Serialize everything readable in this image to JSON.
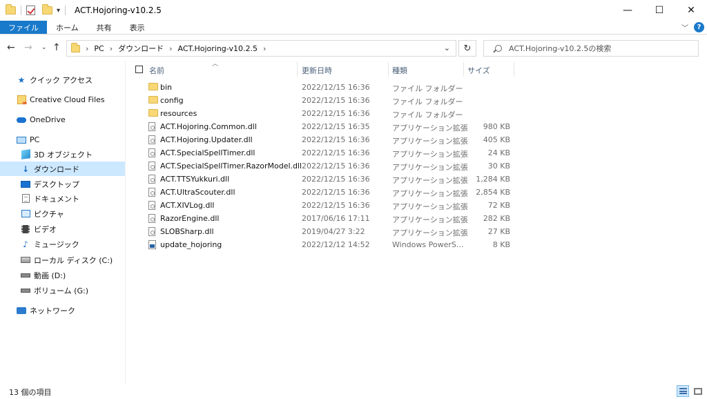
{
  "window": {
    "title": "ACT.Hojoring-v10.2.5",
    "controls": {
      "minimize": "—",
      "maximize": "☐",
      "close": "✕"
    }
  },
  "ribbon": {
    "tabs": [
      "ファイル",
      "ホーム",
      "共有",
      "表示"
    ],
    "help": "?"
  },
  "address": {
    "crumbs": [
      "PC",
      "ダウンロード",
      "ACT.Hojoring-v10.2.5"
    ],
    "separator": "›"
  },
  "search": {
    "placeholder": "ACT.Hojoring-v10.2.5の検索"
  },
  "sidebar": {
    "items": [
      {
        "label": "クイック アクセス",
        "icon": "star-icon"
      },
      {
        "label": "Creative Cloud Files",
        "icon": "creative-cloud-icon"
      },
      {
        "label": "OneDrive",
        "icon": "onedrive-icon"
      },
      {
        "label": "PC",
        "icon": "pc-icon"
      },
      {
        "label": "3D オブジェクト",
        "icon": "3d-objects-icon"
      },
      {
        "label": "ダウンロード",
        "icon": "download-icon",
        "selected": true
      },
      {
        "label": "デスクトップ",
        "icon": "desktop-icon"
      },
      {
        "label": "ドキュメント",
        "icon": "documents-icon"
      },
      {
        "label": "ピクチャ",
        "icon": "pictures-icon"
      },
      {
        "label": "ビデオ",
        "icon": "videos-icon"
      },
      {
        "label": "ミュージック",
        "icon": "music-icon"
      },
      {
        "label": "ローカル ディスク (C:)",
        "icon": "local-disk-icon"
      },
      {
        "label": "動画 (D:)",
        "icon": "drive-icon"
      },
      {
        "label": "ボリューム (G:)",
        "icon": "drive-icon"
      },
      {
        "label": "ネットワーク",
        "icon": "network-icon"
      }
    ]
  },
  "columns": {
    "name": "名前",
    "date": "更新日時",
    "type": "種類",
    "size": "サイズ"
  },
  "files": [
    {
      "name": "bin",
      "date": "2022/12/15 16:36",
      "type": "ファイル フォルダー",
      "size": "",
      "kind": "folder"
    },
    {
      "name": "config",
      "date": "2022/12/15 16:36",
      "type": "ファイル フォルダー",
      "size": "",
      "kind": "folder"
    },
    {
      "name": "resources",
      "date": "2022/12/15 16:36",
      "type": "ファイル フォルダー",
      "size": "",
      "kind": "folder"
    },
    {
      "name": "ACT.Hojoring.Common.dll",
      "date": "2022/12/15 16:35",
      "type": "アプリケーション拡張",
      "size": "980 KB",
      "kind": "dll"
    },
    {
      "name": "ACT.Hojoring.Updater.dll",
      "date": "2022/12/15 16:36",
      "type": "アプリケーション拡張",
      "size": "405 KB",
      "kind": "dll"
    },
    {
      "name": "ACT.SpecialSpellTimer.dll",
      "date": "2022/12/15 16:36",
      "type": "アプリケーション拡張",
      "size": "24 KB",
      "kind": "dll"
    },
    {
      "name": "ACT.SpecialSpellTimer.RazorModel.dll",
      "date": "2022/12/15 16:36",
      "type": "アプリケーション拡張",
      "size": "30 KB",
      "kind": "dll"
    },
    {
      "name": "ACT.TTSYukkuri.dll",
      "date": "2022/12/15 16:36",
      "type": "アプリケーション拡張",
      "size": "1,284 KB",
      "kind": "dll"
    },
    {
      "name": "ACT.UltraScouter.dll",
      "date": "2022/12/15 16:36",
      "type": "アプリケーション拡張",
      "size": "2,854 KB",
      "kind": "dll"
    },
    {
      "name": "ACT.XIVLog.dll",
      "date": "2022/12/15 16:36",
      "type": "アプリケーション拡張",
      "size": "72 KB",
      "kind": "dll"
    },
    {
      "name": "RazorEngine.dll",
      "date": "2017/06/16 17:11",
      "type": "アプリケーション拡張",
      "size": "282 KB",
      "kind": "dll"
    },
    {
      "name": "SLOBSharp.dll",
      "date": "2019/04/27 3:22",
      "type": "アプリケーション拡張",
      "size": "27 KB",
      "kind": "dll"
    },
    {
      "name": "update_hojoring",
      "date": "2022/12/12 14:52",
      "type": "Windows PowerS...",
      "size": "8 KB",
      "kind": "ps1"
    }
  ],
  "status": {
    "item_count": "13 個の項目"
  }
}
